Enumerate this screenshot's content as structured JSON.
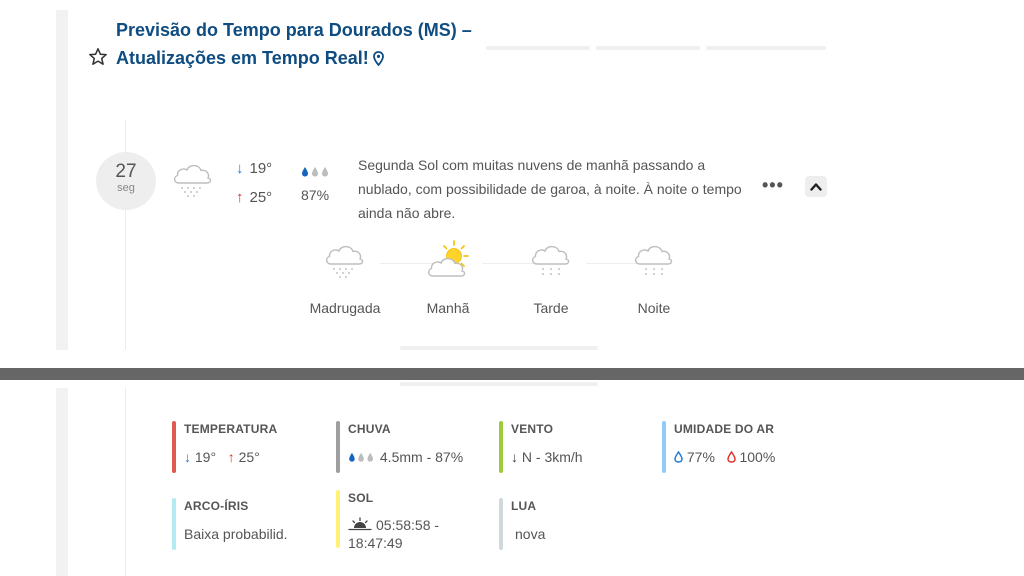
{
  "header": {
    "title": "Previsão do Tempo para Dourados (MS) – Atualizações em Tempo Real!"
  },
  "day": {
    "date_number": "27",
    "weekday": "seg",
    "weather_icon": "cloud-drizzle-icon",
    "temp_min": "19°",
    "temp_max": "25°",
    "rain_probability": "87%",
    "description": "Segunda Sol com muitas nuvens de manhã passando a nublado, com possibilidade de garoa, à noite. À noite o tempo ainda não abre."
  },
  "periods": [
    {
      "label": "Madrugada",
      "icon": "cloud-drizzle-icon"
    },
    {
      "label": "Manhã",
      "icon": "sun-cloud-icon"
    },
    {
      "label": "Tarde",
      "icon": "cloud-light-rain-icon"
    },
    {
      "label": "Noite",
      "icon": "cloud-light-rain-icon"
    }
  ],
  "details": {
    "temperatura": {
      "title": "TEMPERATURA",
      "min": "19°",
      "max": "25°"
    },
    "chuva": {
      "title": "CHUVA",
      "value": "4.5mm - 87%"
    },
    "vento": {
      "title": "VENTO",
      "value": "N - 3km/h"
    },
    "umidade": {
      "title": "UMIDADE DO AR",
      "min": "77%",
      "max": "100%"
    },
    "arco_iris": {
      "title": "ARCO-ÍRIS",
      "value": "Baixa probabilid."
    },
    "sol": {
      "title": "SOL",
      "value": "05:58:58 - 18:47:49"
    },
    "lua": {
      "title": "LUA",
      "value": "nova"
    }
  },
  "colors": {
    "title": "#0f4c81",
    "temperatura": "#e05a4f",
    "chuva": "#9e9e9e",
    "vento": "#9ccc3c",
    "umidade": "#90caf9",
    "arco_iris": "#b2ebf2",
    "sol": "#fff176",
    "lua": "#cfd8dc"
  }
}
